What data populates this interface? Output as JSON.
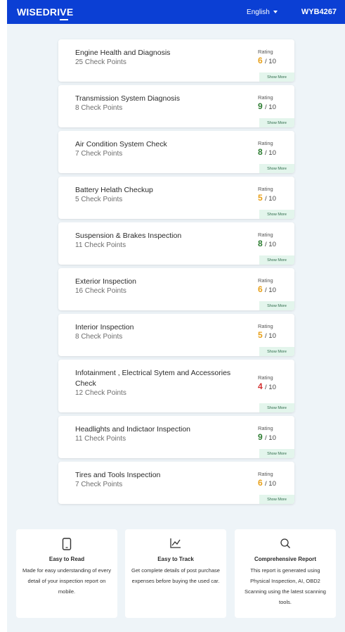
{
  "header": {
    "logo": "WISEDRIVE",
    "language": "English",
    "plate": "WYB4267"
  },
  "colors": {
    "header_bg": "#0b3fd4",
    "rating_orange": "#e8a11b",
    "rating_green": "#2e7d32",
    "rating_red": "#d32f2f",
    "show_more_bg": "#e3f5ec"
  },
  "rating_label": "Rating",
  "show_more_label": "Show More",
  "inspections": [
    {
      "name": "Engine Health and Diagnosis",
      "checkpoints": "25 Check Points",
      "score": "6",
      "max": "/ 10",
      "score_color": "#e8a11b"
    },
    {
      "name": "Transmission System Diagnosis",
      "checkpoints": "8 Check Points",
      "score": "9",
      "max": "/ 10",
      "score_color": "#2e7d32"
    },
    {
      "name": "Air Condition System Check",
      "checkpoints": "7 Check Points",
      "score": "8",
      "max": "/ 10",
      "score_color": "#2e7d32"
    },
    {
      "name": "Battery Helath Checkup",
      "checkpoints": "5 Check Points",
      "score": "5",
      "max": "/ 10",
      "score_color": "#e8a11b"
    },
    {
      "name": "Suspension & Brakes Inspection",
      "checkpoints": "11 Check Points",
      "score": "8",
      "max": "/ 10",
      "score_color": "#2e7d32"
    },
    {
      "name": "Exterior Inspection",
      "checkpoints": "16 Check Points",
      "score": "6",
      "max": "/ 10",
      "score_color": "#e8a11b"
    },
    {
      "name": "Interior Inspection",
      "checkpoints": "8 Check Points",
      "score": "5",
      "max": "/ 10",
      "score_color": "#e8a11b"
    },
    {
      "name": "Infotainment , Electrical Sytem and Accessories Check",
      "checkpoints": "12 Check Points",
      "score": "4",
      "max": "/ 10",
      "score_color": "#d32f2f"
    },
    {
      "name": "Headlights and Indictaor Inspection",
      "checkpoints": "11 Check Points",
      "score": "9",
      "max": "/ 10",
      "score_color": "#2e7d32"
    },
    {
      "name": "Tires and Tools Inspection",
      "checkpoints": "7 Check Points",
      "score": "6",
      "max": "/ 10",
      "score_color": "#e8a11b"
    }
  ],
  "features": [
    {
      "icon": "mobile-phone-icon",
      "title": "Easy to Read",
      "description": "Made for easy understanding of every detail of your inspection report on mobile."
    },
    {
      "icon": "line-chart-icon",
      "title": "Easy to Track",
      "description": "Get complete details of post purchase expenses before buying the used car."
    },
    {
      "icon": "search-icon",
      "title": "Comprehensive Report",
      "description": "This report is generated using Physical Inspection, AI, OBD2 Scanning using the latest scanning tools."
    }
  ]
}
